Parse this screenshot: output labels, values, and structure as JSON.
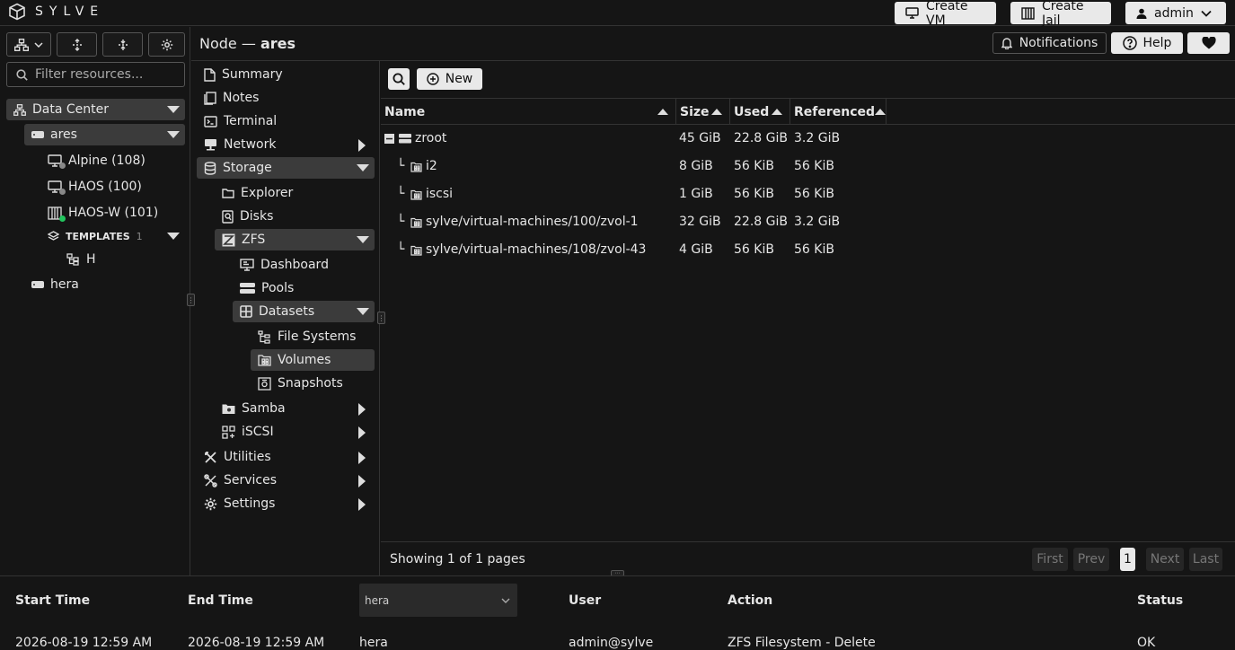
{
  "app": {
    "name": "SYLVE"
  },
  "topbar": {
    "create_vm": "Create VM",
    "create_jail": "Create Jail",
    "user": "admin"
  },
  "left": {
    "filter_placeholder": "Filter resources...",
    "tree": {
      "datacenter": "Data Center",
      "node_ares": "ares",
      "vm1": "Alpine (108)",
      "vm2": "HAOS (100)",
      "vm3": "HAOS-W (101)",
      "templates_label": "TEMPLATES",
      "templates_count": "1",
      "template1": "H",
      "node_hera": "hera"
    }
  },
  "header": {
    "prefix": "Node —",
    "node": "ares",
    "notifications": "Notifications",
    "help": "Help"
  },
  "nav": {
    "summary": "Summary",
    "notes": "Notes",
    "terminal": "Terminal",
    "network": "Network",
    "storage": "Storage",
    "explorer": "Explorer",
    "disks": "Disks",
    "zfs": "ZFS",
    "dashboard": "Dashboard",
    "pools": "Pools",
    "datasets": "Datasets",
    "filesystems": "File Systems",
    "volumes": "Volumes",
    "snapshots": "Snapshots",
    "samba": "Samba",
    "iscsi": "iSCSI",
    "utilities": "Utilities",
    "services": "Services",
    "settings": "Settings"
  },
  "main": {
    "new_button": "New",
    "columns": [
      "Name",
      "Size",
      "Used",
      "Referenced"
    ],
    "rows": [
      {
        "name": "zroot",
        "size": "45 GiB",
        "used": "22.8 GiB",
        "ref": "3.2 GiB"
      },
      {
        "name": "i2",
        "size": "8 GiB",
        "used": "56 KiB",
        "ref": "56 KiB"
      },
      {
        "name": "iscsi",
        "size": "1 GiB",
        "used": "56 KiB",
        "ref": "56 KiB"
      },
      {
        "name": "sylve/virtual-machines/100/zvol-1",
        "size": "32 GiB",
        "used": "22.8 GiB",
        "ref": "3.2 GiB"
      },
      {
        "name": "sylve/virtual-machines/108/zvol-43",
        "size": "4 GiB",
        "used": "56 KiB",
        "ref": "56 KiB"
      }
    ],
    "footer_text": "Showing 1 of 1 pages",
    "pager": {
      "first": "First",
      "prev": "Prev",
      "page": "1",
      "next": "Next",
      "last": "Last"
    }
  },
  "bottom": {
    "headers": {
      "start": "Start Time",
      "end": "End Time",
      "user": "User",
      "action": "Action",
      "status": "Status"
    },
    "node_select": "hera",
    "row": {
      "start": "2026-08-19 12:59 AM",
      "end": "2026-08-19 12:59 AM",
      "node": "hera",
      "user": "admin@sylve",
      "action": "ZFS Filesystem - Delete",
      "status": "OK"
    }
  },
  "colors": {
    "bg": "#151515",
    "selected": "#3b3b3b",
    "online": "#22c55e",
    "offline": "#888888"
  }
}
